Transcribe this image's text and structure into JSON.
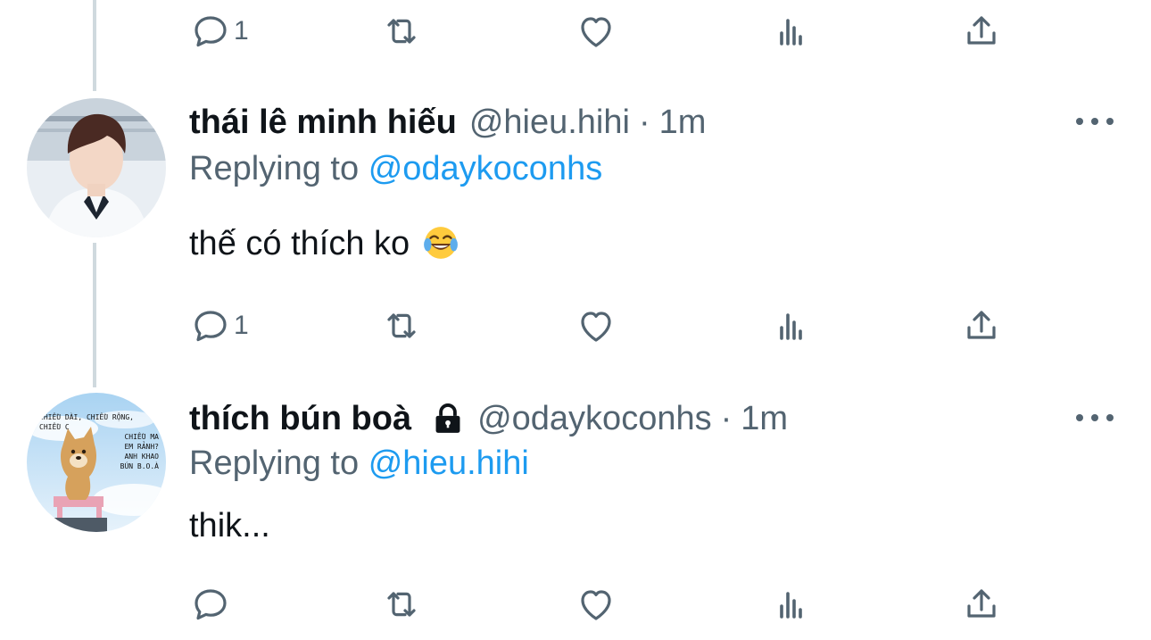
{
  "tweets": [
    {
      "actions": {
        "reply_count": "1"
      }
    },
    {
      "display_name": "thái lê minh hiếu",
      "handle": "@hieu.hihi",
      "separator": "·",
      "time": "1m",
      "replying_prefix": "Replying to",
      "replying_to": "@odaykoconhs",
      "text": "thế có thích ko",
      "emoji": "joy-face-emoji",
      "actions": {
        "reply_count": "1"
      }
    },
    {
      "display_name": "thích bún boà",
      "protected_icon": "lock-icon",
      "handle": "@odaykoconhs",
      "separator": "·",
      "time": "1m",
      "replying_prefix": "Replying to",
      "replying_to": "@hieu.hihi",
      "text": "thik...",
      "avatar_caption": [
        "CHIỀU DÀI, CHIỀU RỘNG, CHIỀU C",
        "CHIỀU MA",
        "EM RẢNH?",
        "ANH KHAO",
        "BÚN B.O.À"
      ],
      "actions": {
        "reply_count": ""
      }
    }
  ],
  "icons": {
    "reply": "reply-icon",
    "retweet": "retweet-icon",
    "like": "heart-icon",
    "analytics": "analytics-icon",
    "share": "share-icon",
    "more": "more-icon"
  },
  "colors": {
    "text_primary": "#0f1419",
    "text_secondary": "#536471",
    "accent": "#1d9bf0",
    "thread_line": "#cfd9de"
  }
}
